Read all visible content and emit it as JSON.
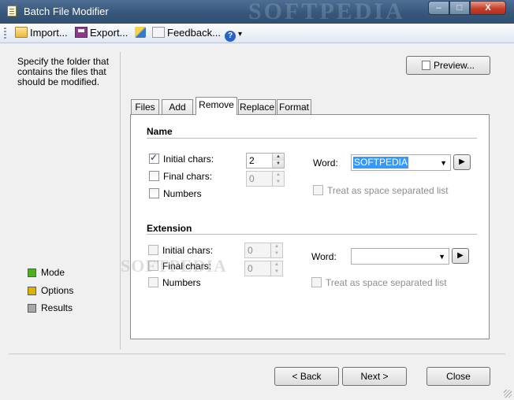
{
  "window": {
    "title": "Batch File Modifier",
    "watermark": "SOFTPEDIA",
    "controls": {
      "minimize": "–",
      "maximize": "□",
      "close": "X"
    }
  },
  "toolbar": {
    "import_label": "Import...",
    "export_label": "Export...",
    "feedback_label": "Feedback...",
    "help_symbol": "?",
    "help_arrow": "▾"
  },
  "sidebar": {
    "description": "Specify the folder that contains the files that should be modified.",
    "steps": [
      {
        "label": "Mode",
        "color": "#4caf20"
      },
      {
        "label": "Options",
        "color": "#e0b000"
      },
      {
        "label": "Results",
        "color": "#a8a8a8"
      }
    ]
  },
  "preview_label": "Preview...",
  "tabs": [
    "Files",
    "Add",
    "Remove",
    "Replace",
    "Format"
  ],
  "active_tab": "Remove",
  "name_section": {
    "title": "Name",
    "initial_chars": {
      "label": "Initial chars:",
      "checked": true,
      "value": "2"
    },
    "final_chars": {
      "label": "Final chars:",
      "checked": false,
      "value": "0"
    },
    "numbers": {
      "label": "Numbers",
      "checked": false
    },
    "word_label": "Word:",
    "word_value": "SOFTPEDIA",
    "space_list_label": "Treat as space separated list"
  },
  "extension_section": {
    "title": "Extension",
    "initial_chars": {
      "label": "Initial chars:",
      "checked": false,
      "value": "0"
    },
    "final_chars": {
      "label": "Final chars:",
      "checked": false,
      "value": "0"
    },
    "numbers": {
      "label": "Numbers",
      "checked": false
    },
    "word_label": "Word:",
    "word_value": "",
    "space_list_label": "Treat as space separated list"
  },
  "panel_watermark": "SOFTPEDIA",
  "footer": {
    "back_label": "< Back",
    "next_label": "Next >",
    "close_label": "Close"
  },
  "icons": {
    "go_arrow": "▶",
    "dropdown_arrow": "▼",
    "spin_up": "▲",
    "spin_down": "▼"
  }
}
